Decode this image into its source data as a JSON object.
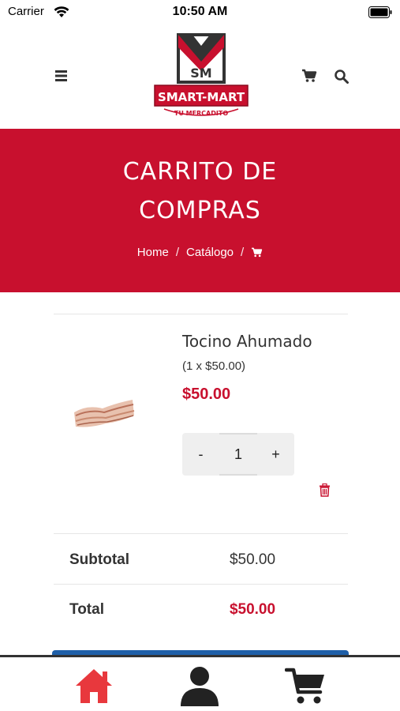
{
  "status_bar": {
    "carrier": "Carrier",
    "time": "10:50 AM"
  },
  "header": {
    "logo_text": "SMART-MART",
    "logo_subtext": "TU MERCADITO",
    "logo_monogram": "SM"
  },
  "banner": {
    "title_line1": "CARRITO DE",
    "title_line2": "COMPRAS",
    "breadcrumb": {
      "home": "Home",
      "separator": "/",
      "catalog": "Catálogo"
    }
  },
  "cart_item": {
    "name": "Tocino Ahumado",
    "qty_price": "(1 x $50.00)",
    "total": "$50.00",
    "quantity": "1",
    "minus_label": "-",
    "plus_label": "+"
  },
  "summary": {
    "subtotal_label": "Subtotal",
    "subtotal_value": "$50.00",
    "total_label": "Total",
    "total_value": "$50.00"
  },
  "colors": {
    "brand_red": "#c8102e",
    "tab_active": "#e8383d",
    "tab_inactive": "#222222",
    "checkout_blue": "#1f5fa8"
  },
  "tabs": [
    {
      "icon": "home-icon",
      "active": true
    },
    {
      "icon": "user-icon",
      "active": false
    },
    {
      "icon": "cart-icon",
      "active": false
    }
  ]
}
